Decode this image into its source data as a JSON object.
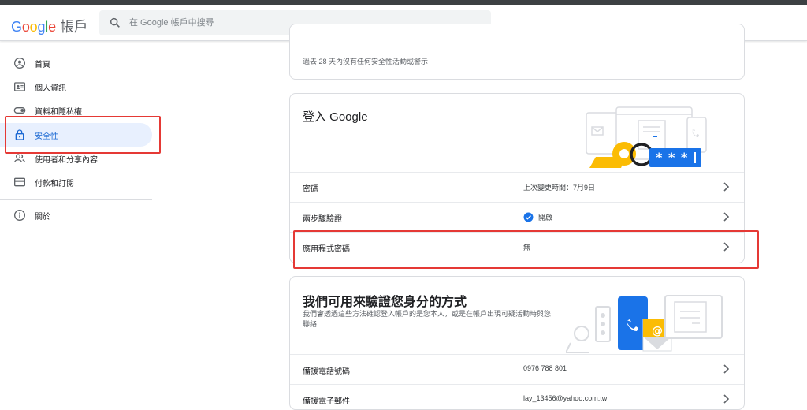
{
  "header": {
    "logo_google": [
      "G",
      "o",
      "o",
      "g",
      "l",
      "e"
    ],
    "product": "帳戶",
    "search_placeholder": "在 Google 帳戶中搜尋"
  },
  "sidebar": {
    "items": [
      {
        "label": "首頁",
        "icon": "person-circle-icon"
      },
      {
        "label": "個人資訊",
        "icon": "id-card-icon"
      },
      {
        "label": "資料和隱私權",
        "icon": "toggle-icon"
      },
      {
        "label": "安全性",
        "icon": "lock-icon",
        "active": true
      },
      {
        "label": "使用者和分享內容",
        "icon": "people-icon"
      },
      {
        "label": "付款和訂閱",
        "icon": "credit-card-icon"
      }
    ],
    "about": {
      "label": "關於",
      "icon": "info-icon"
    }
  },
  "activity_card": {
    "status": "過去 28 天內沒有任何安全性活動或警示"
  },
  "signin_card": {
    "title": "登入 Google",
    "rows": [
      {
        "label": "密碼",
        "value": "上次變更時間：7月9日"
      },
      {
        "label": "兩步驟驗證",
        "value": "開啟",
        "status_icon": "check-circle-icon"
      },
      {
        "label": "應用程式密碼",
        "value": "無"
      }
    ]
  },
  "verify_card": {
    "title": "我們可用來驗證您身分的方式",
    "desc": "我們會透過這些方法確認登入帳戶的是您本人，或是在帳戶出現可疑活動時與您聯絡",
    "rows": [
      {
        "label": "備援電話號碼",
        "value": "0976 788 801"
      },
      {
        "label": "備援電子郵件",
        "value": "lay_13456@yahoo.com.tw"
      }
    ]
  },
  "colors": {
    "accent": "#1a73e8",
    "active_bg": "#e8f0fe",
    "highlight": "#e53935",
    "key_yellow": "#fbbc04"
  }
}
